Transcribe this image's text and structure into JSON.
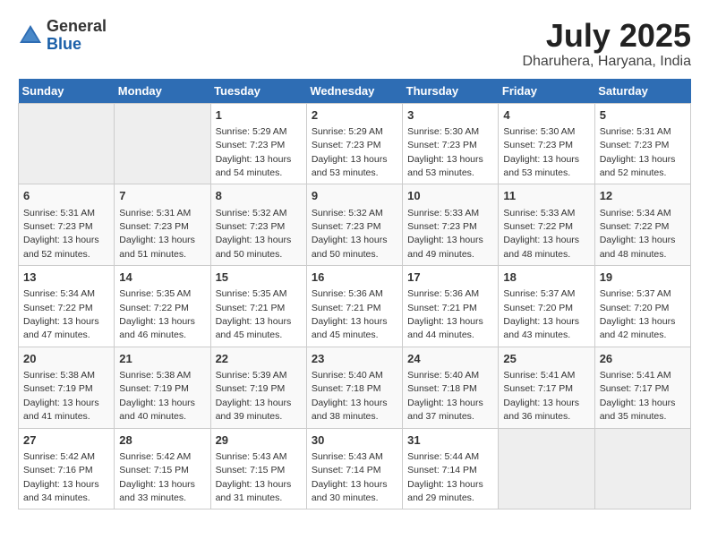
{
  "header": {
    "logo_general": "General",
    "logo_blue": "Blue",
    "month_title": "July 2025",
    "location": "Dharuhera, Haryana, India"
  },
  "days_of_week": [
    "Sunday",
    "Monday",
    "Tuesday",
    "Wednesday",
    "Thursday",
    "Friday",
    "Saturday"
  ],
  "weeks": [
    [
      {
        "day": "",
        "empty": true
      },
      {
        "day": "",
        "empty": true
      },
      {
        "day": "1",
        "sunrise": "Sunrise: 5:29 AM",
        "sunset": "Sunset: 7:23 PM",
        "daylight": "Daylight: 13 hours and 54 minutes."
      },
      {
        "day": "2",
        "sunrise": "Sunrise: 5:29 AM",
        "sunset": "Sunset: 7:23 PM",
        "daylight": "Daylight: 13 hours and 53 minutes."
      },
      {
        "day": "3",
        "sunrise": "Sunrise: 5:30 AM",
        "sunset": "Sunset: 7:23 PM",
        "daylight": "Daylight: 13 hours and 53 minutes."
      },
      {
        "day": "4",
        "sunrise": "Sunrise: 5:30 AM",
        "sunset": "Sunset: 7:23 PM",
        "daylight": "Daylight: 13 hours and 53 minutes."
      },
      {
        "day": "5",
        "sunrise": "Sunrise: 5:31 AM",
        "sunset": "Sunset: 7:23 PM",
        "daylight": "Daylight: 13 hours and 52 minutes."
      }
    ],
    [
      {
        "day": "6",
        "sunrise": "Sunrise: 5:31 AM",
        "sunset": "Sunset: 7:23 PM",
        "daylight": "Daylight: 13 hours and 52 minutes."
      },
      {
        "day": "7",
        "sunrise": "Sunrise: 5:31 AM",
        "sunset": "Sunset: 7:23 PM",
        "daylight": "Daylight: 13 hours and 51 minutes."
      },
      {
        "day": "8",
        "sunrise": "Sunrise: 5:32 AM",
        "sunset": "Sunset: 7:23 PM",
        "daylight": "Daylight: 13 hours and 50 minutes."
      },
      {
        "day": "9",
        "sunrise": "Sunrise: 5:32 AM",
        "sunset": "Sunset: 7:23 PM",
        "daylight": "Daylight: 13 hours and 50 minutes."
      },
      {
        "day": "10",
        "sunrise": "Sunrise: 5:33 AM",
        "sunset": "Sunset: 7:23 PM",
        "daylight": "Daylight: 13 hours and 49 minutes."
      },
      {
        "day": "11",
        "sunrise": "Sunrise: 5:33 AM",
        "sunset": "Sunset: 7:22 PM",
        "daylight": "Daylight: 13 hours and 48 minutes."
      },
      {
        "day": "12",
        "sunrise": "Sunrise: 5:34 AM",
        "sunset": "Sunset: 7:22 PM",
        "daylight": "Daylight: 13 hours and 48 minutes."
      }
    ],
    [
      {
        "day": "13",
        "sunrise": "Sunrise: 5:34 AM",
        "sunset": "Sunset: 7:22 PM",
        "daylight": "Daylight: 13 hours and 47 minutes."
      },
      {
        "day": "14",
        "sunrise": "Sunrise: 5:35 AM",
        "sunset": "Sunset: 7:22 PM",
        "daylight": "Daylight: 13 hours and 46 minutes."
      },
      {
        "day": "15",
        "sunrise": "Sunrise: 5:35 AM",
        "sunset": "Sunset: 7:21 PM",
        "daylight": "Daylight: 13 hours and 45 minutes."
      },
      {
        "day": "16",
        "sunrise": "Sunrise: 5:36 AM",
        "sunset": "Sunset: 7:21 PM",
        "daylight": "Daylight: 13 hours and 45 minutes."
      },
      {
        "day": "17",
        "sunrise": "Sunrise: 5:36 AM",
        "sunset": "Sunset: 7:21 PM",
        "daylight": "Daylight: 13 hours and 44 minutes."
      },
      {
        "day": "18",
        "sunrise": "Sunrise: 5:37 AM",
        "sunset": "Sunset: 7:20 PM",
        "daylight": "Daylight: 13 hours and 43 minutes."
      },
      {
        "day": "19",
        "sunrise": "Sunrise: 5:37 AM",
        "sunset": "Sunset: 7:20 PM",
        "daylight": "Daylight: 13 hours and 42 minutes."
      }
    ],
    [
      {
        "day": "20",
        "sunrise": "Sunrise: 5:38 AM",
        "sunset": "Sunset: 7:19 PM",
        "daylight": "Daylight: 13 hours and 41 minutes."
      },
      {
        "day": "21",
        "sunrise": "Sunrise: 5:38 AM",
        "sunset": "Sunset: 7:19 PM",
        "daylight": "Daylight: 13 hours and 40 minutes."
      },
      {
        "day": "22",
        "sunrise": "Sunrise: 5:39 AM",
        "sunset": "Sunset: 7:19 PM",
        "daylight": "Daylight: 13 hours and 39 minutes."
      },
      {
        "day": "23",
        "sunrise": "Sunrise: 5:40 AM",
        "sunset": "Sunset: 7:18 PM",
        "daylight": "Daylight: 13 hours and 38 minutes."
      },
      {
        "day": "24",
        "sunrise": "Sunrise: 5:40 AM",
        "sunset": "Sunset: 7:18 PM",
        "daylight": "Daylight: 13 hours and 37 minutes."
      },
      {
        "day": "25",
        "sunrise": "Sunrise: 5:41 AM",
        "sunset": "Sunset: 7:17 PM",
        "daylight": "Daylight: 13 hours and 36 minutes."
      },
      {
        "day": "26",
        "sunrise": "Sunrise: 5:41 AM",
        "sunset": "Sunset: 7:17 PM",
        "daylight": "Daylight: 13 hours and 35 minutes."
      }
    ],
    [
      {
        "day": "27",
        "sunrise": "Sunrise: 5:42 AM",
        "sunset": "Sunset: 7:16 PM",
        "daylight": "Daylight: 13 hours and 34 minutes."
      },
      {
        "day": "28",
        "sunrise": "Sunrise: 5:42 AM",
        "sunset": "Sunset: 7:15 PM",
        "daylight": "Daylight: 13 hours and 33 minutes."
      },
      {
        "day": "29",
        "sunrise": "Sunrise: 5:43 AM",
        "sunset": "Sunset: 7:15 PM",
        "daylight": "Daylight: 13 hours and 31 minutes."
      },
      {
        "day": "30",
        "sunrise": "Sunrise: 5:43 AM",
        "sunset": "Sunset: 7:14 PM",
        "daylight": "Daylight: 13 hours and 30 minutes."
      },
      {
        "day": "31",
        "sunrise": "Sunrise: 5:44 AM",
        "sunset": "Sunset: 7:14 PM",
        "daylight": "Daylight: 13 hours and 29 minutes."
      },
      {
        "day": "",
        "empty": true
      },
      {
        "day": "",
        "empty": true
      }
    ]
  ]
}
